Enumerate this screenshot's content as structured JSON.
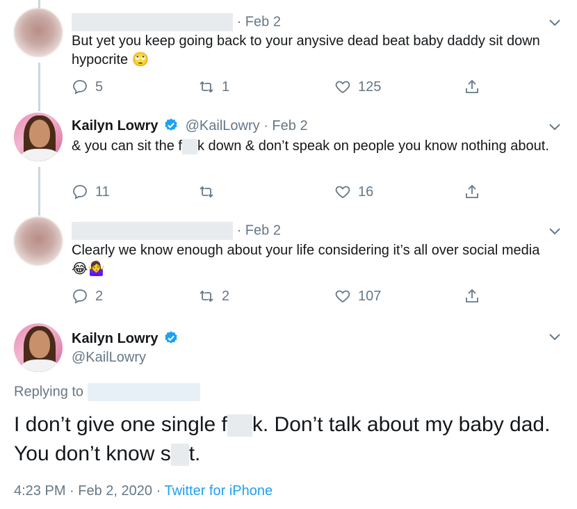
{
  "tweets": [
    {
      "author_name": "",
      "handle": "",
      "date": "Feb 2",
      "text": "But yet you keep going back to your anysive dead beat baby daddy sit down hypocrite",
      "emoji": "🙄",
      "replies": "5",
      "retweets": "1",
      "likes": "125"
    },
    {
      "author_name": "Kailyn Lowry",
      "handle": "@KailLowry",
      "date": "Feb 2",
      "text_a": "& you can sit the f",
      "text_b": "k down & don’t speak on people you know nothing about.",
      "replies": "11",
      "retweets": "",
      "likes": "16"
    },
    {
      "author_name": "",
      "handle": "",
      "date": "Feb 2",
      "text": "Clearly we know enough about your life considering it’s all over social media",
      "emoji": "😂🤷‍♀️",
      "replies": "2",
      "retweets": "2",
      "likes": "107"
    }
  ],
  "main_tweet": {
    "author_name": "Kailyn Lowry",
    "handle": "@KailLowry",
    "replying_to_label": "Replying to",
    "text_a": "I don’t give one single f",
    "text_b": "k. Don’t talk about my baby dad. You don’t know s",
    "text_c": "t.",
    "time": "4:23 PM",
    "date": "Feb 2, 2020",
    "source": "Twitter for iPhone"
  },
  "separators": {
    "dot": "·"
  },
  "colors": {
    "text": "#14171a",
    "secondary": "#657786",
    "verified": "#1da1f2",
    "link": "#1da1f2",
    "thread_line": "#ccd6dd"
  },
  "icons": {
    "reply": "reply-icon",
    "retweet": "retweet-icon",
    "like": "heart-icon",
    "share": "share-icon",
    "more": "chevron-down-icon",
    "verified": "verified-badge-icon"
  }
}
